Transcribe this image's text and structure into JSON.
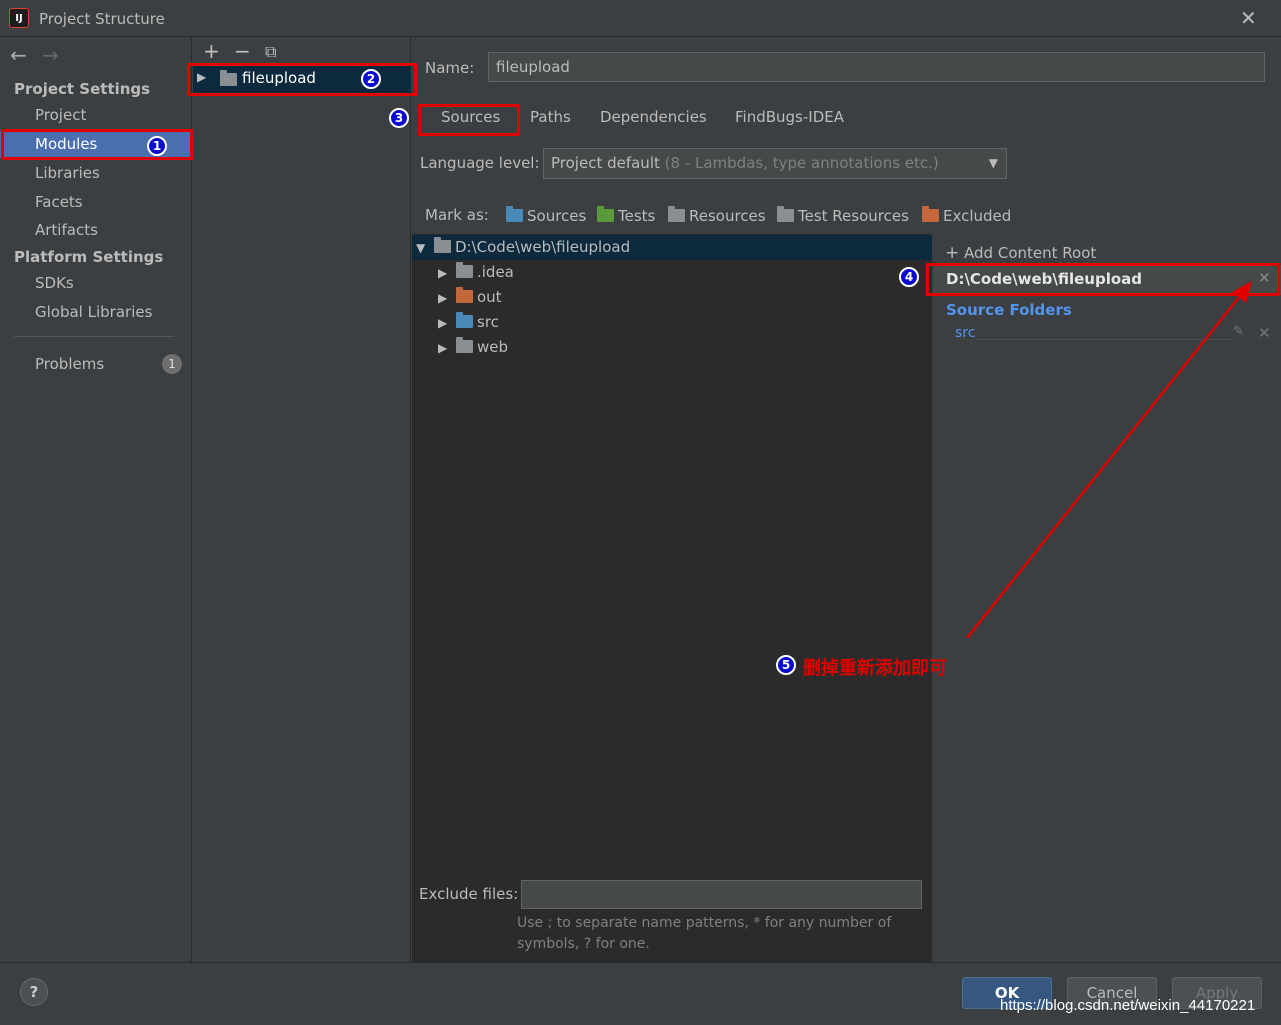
{
  "window": {
    "title": "Project Structure",
    "app_icon": "IJ"
  },
  "sidebar": {
    "project_settings_head": "Project Settings",
    "platform_settings_head": "Platform Settings",
    "items": [
      "Project",
      "Modules",
      "Libraries",
      "Facets",
      "Artifacts"
    ],
    "platform_items": [
      "SDKs",
      "Global Libraries"
    ],
    "problems": {
      "label": "Problems",
      "count": "1"
    }
  },
  "modules": {
    "toolbar": [
      "+",
      "−",
      "⧉"
    ],
    "selected": "fileupload"
  },
  "detail": {
    "name_label": "Name:",
    "name_value": "fileupload",
    "tabs": [
      "Sources",
      "Paths",
      "Dependencies",
      "FindBugs-IDEA"
    ],
    "language_label": "Language level:",
    "language_value": "Project default",
    "language_hint": "(8 - Lambdas, type annotations etc.)",
    "mark_as_label": "Mark as:",
    "mark_as": [
      {
        "label": "Sources",
        "color": "#4a8ab8"
      },
      {
        "label": "Tests",
        "color": "#5a9a3a"
      },
      {
        "label": "Resources",
        "color": "#8a8f94"
      },
      {
        "label": "Test Resources",
        "color": "#8a8f94"
      },
      {
        "label": "Excluded",
        "color": "#c5673c"
      }
    ],
    "tree_root": "D:\\Code\\web\\fileupload",
    "tree_children": [
      {
        "label": ".idea",
        "color": "#8a8f94"
      },
      {
        "label": "out",
        "color": "#c5673c"
      },
      {
        "label": "src",
        "color": "#4a8ab8"
      },
      {
        "label": "web",
        "color": "#8a8f94"
      }
    ],
    "exclude_label": "Exclude files:",
    "exclude_hint_1": "Use ; to separate name patterns, * for any number of",
    "exclude_hint_2": "symbols, ? for one."
  },
  "content_root": {
    "add_label": "Add Content Root",
    "path": "D:\\Code\\web\\fileupload",
    "source_folders_head": "Source Folders",
    "source_folder": "src"
  },
  "annotations": {
    "n1": "1",
    "n2": "2",
    "n3": "3",
    "n4": "4",
    "n5": "5",
    "note": "删掉重新添加即可",
    "arrow_color": "#e00000"
  },
  "buttons": {
    "ok": "OK",
    "cancel": "Cancel",
    "apply": "Apply",
    "help": "?"
  },
  "watermark": "https://blog.csdn.net/weixin_44170221"
}
